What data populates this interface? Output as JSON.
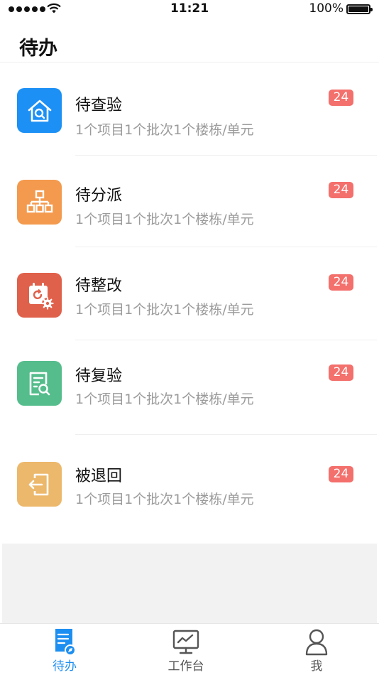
{
  "status_bar": {
    "time": "11:21",
    "battery": "100%"
  },
  "header": {
    "title": "待办"
  },
  "tasks": [
    {
      "title": "待查验",
      "subtitle": "1个项目1个批次1个楼栋/单元",
      "badge": "24",
      "icon": "house-search-icon",
      "color": "#1c90f5"
    },
    {
      "title": "待分派",
      "subtitle": "1个项目1个批次1个楼栋/单元",
      "badge": "24",
      "icon": "org-chart-icon",
      "color": "#f39a4e"
    },
    {
      "title": "待整改",
      "subtitle": "1个项目1个批次1个楼栋/单元",
      "badge": "24",
      "icon": "calendar-gear-icon",
      "color": "#e0614b"
    },
    {
      "title": "待复验",
      "subtitle": "1个项目1个批次1个楼栋/单元",
      "badge": "24",
      "icon": "document-search-icon",
      "color": "#55bd8c"
    },
    {
      "title": "被退回",
      "subtitle": "1个项目1个批次1个楼栋/单元",
      "badge": "24",
      "icon": "exit-door-icon",
      "color": "#ecb86b"
    }
  ],
  "tab_bar": {
    "tabs": [
      {
        "label": "待办",
        "icon": "todo-document-icon",
        "active": true
      },
      {
        "label": "工作台",
        "icon": "monitor-chart-icon",
        "active": false
      },
      {
        "label": "我",
        "icon": "person-icon",
        "active": false
      }
    ]
  },
  "colors": {
    "accent": "#1d8ff1",
    "badge": "#f3706c",
    "subtitle": "#9b9b9b"
  }
}
